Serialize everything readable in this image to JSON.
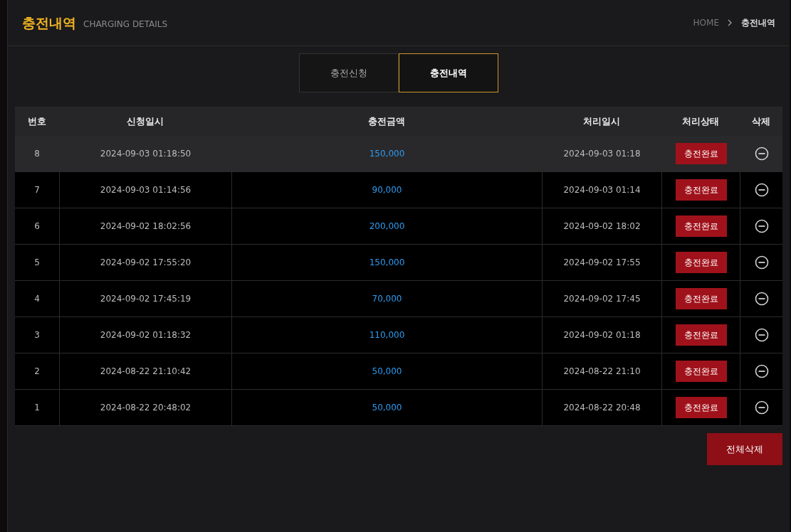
{
  "header": {
    "title": "충전내역",
    "subtitle": "CHARGING DETAILS",
    "breadcrumb": [
      {
        "label": "HOME"
      },
      {
        "label": "충전내역"
      }
    ]
  },
  "tabs": [
    {
      "label": "충전신청",
      "selected": false
    },
    {
      "label": "충전내역",
      "selected": true
    }
  ],
  "table": {
    "columns": [
      "번호",
      "신청일시",
      "충전금액",
      "처리일시",
      "처리상태",
      "삭제"
    ],
    "rows": [
      {
        "no": "8",
        "requested": "2024-09-03 01:18:50",
        "amount": "150,000",
        "processed": "2024-09-03 01:18",
        "status": "충전완료",
        "selected": true
      },
      {
        "no": "7",
        "requested": "2024-09-03 01:14:56",
        "amount": "90,000",
        "processed": "2024-09-03 01:14",
        "status": "충전완료",
        "selected": false
      },
      {
        "no": "6",
        "requested": "2024-09-02 18:02:56",
        "amount": "200,000",
        "processed": "2024-09-02 18:02",
        "status": "충전완료",
        "selected": false
      },
      {
        "no": "5",
        "requested": "2024-09-02 17:55:20",
        "amount": "150,000",
        "processed": "2024-09-02 17:55",
        "status": "충전완료",
        "selected": false
      },
      {
        "no": "4",
        "requested": "2024-09-02 17:45:19",
        "amount": "70,000",
        "processed": "2024-09-02 17:45",
        "status": "충전완료",
        "selected": false
      },
      {
        "no": "3",
        "requested": "2024-09-02 01:18:32",
        "amount": "110,000",
        "processed": "2024-09-02 01:18",
        "status": "충전완료",
        "selected": false
      },
      {
        "no": "2",
        "requested": "2024-08-22 21:10:42",
        "amount": "50,000",
        "processed": "2024-08-22 21:10",
        "status": "충전완료",
        "selected": false
      },
      {
        "no": "1",
        "requested": "2024-08-22 20:48:02",
        "amount": "50,000",
        "processed": "2024-08-22 20:48",
        "status": "충전완료",
        "selected": false
      }
    ]
  },
  "delete_all_button": "전체삭제"
}
